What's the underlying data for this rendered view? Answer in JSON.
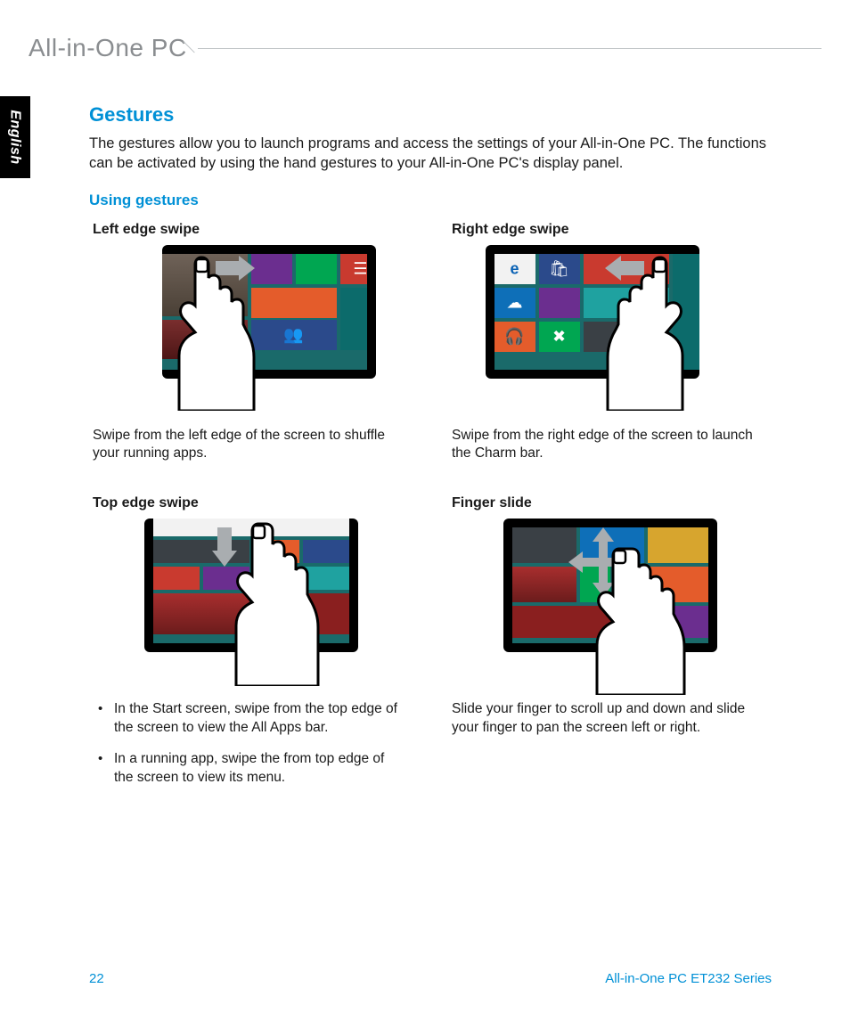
{
  "header": {
    "product_title": "All-in-One PC"
  },
  "language_tab": "English",
  "section": {
    "title": "Gestures",
    "intro": "The gestures allow you to launch programs and access the settings of your All-in-One PC. The functions can be activated by using the hand gestures to your All-in-One PC's display panel.",
    "subsection_title": "Using gestures"
  },
  "gestures": {
    "left_edge": {
      "title": "Left edge swipe",
      "desc": "Swipe from the left edge of the screen to shuffle your running apps."
    },
    "right_edge": {
      "title": "Right edge swipe",
      "desc": "Swipe from the right edge of the screen to launch the Charm bar."
    },
    "top_edge": {
      "title": "Top edge swipe",
      "bullet1": "In the Start screen, swipe from the top edge of the screen to view the All Apps bar.",
      "bullet2": "In a running app, swipe the from top edge of the screen to view its menu."
    },
    "finger_slide": {
      "title": "Finger slide",
      "desc": "Slide your finger to scroll up and down and slide your finger to pan the screen left or right."
    }
  },
  "footer": {
    "page_number": "22",
    "series": "All-in-One PC ET232 Series"
  }
}
